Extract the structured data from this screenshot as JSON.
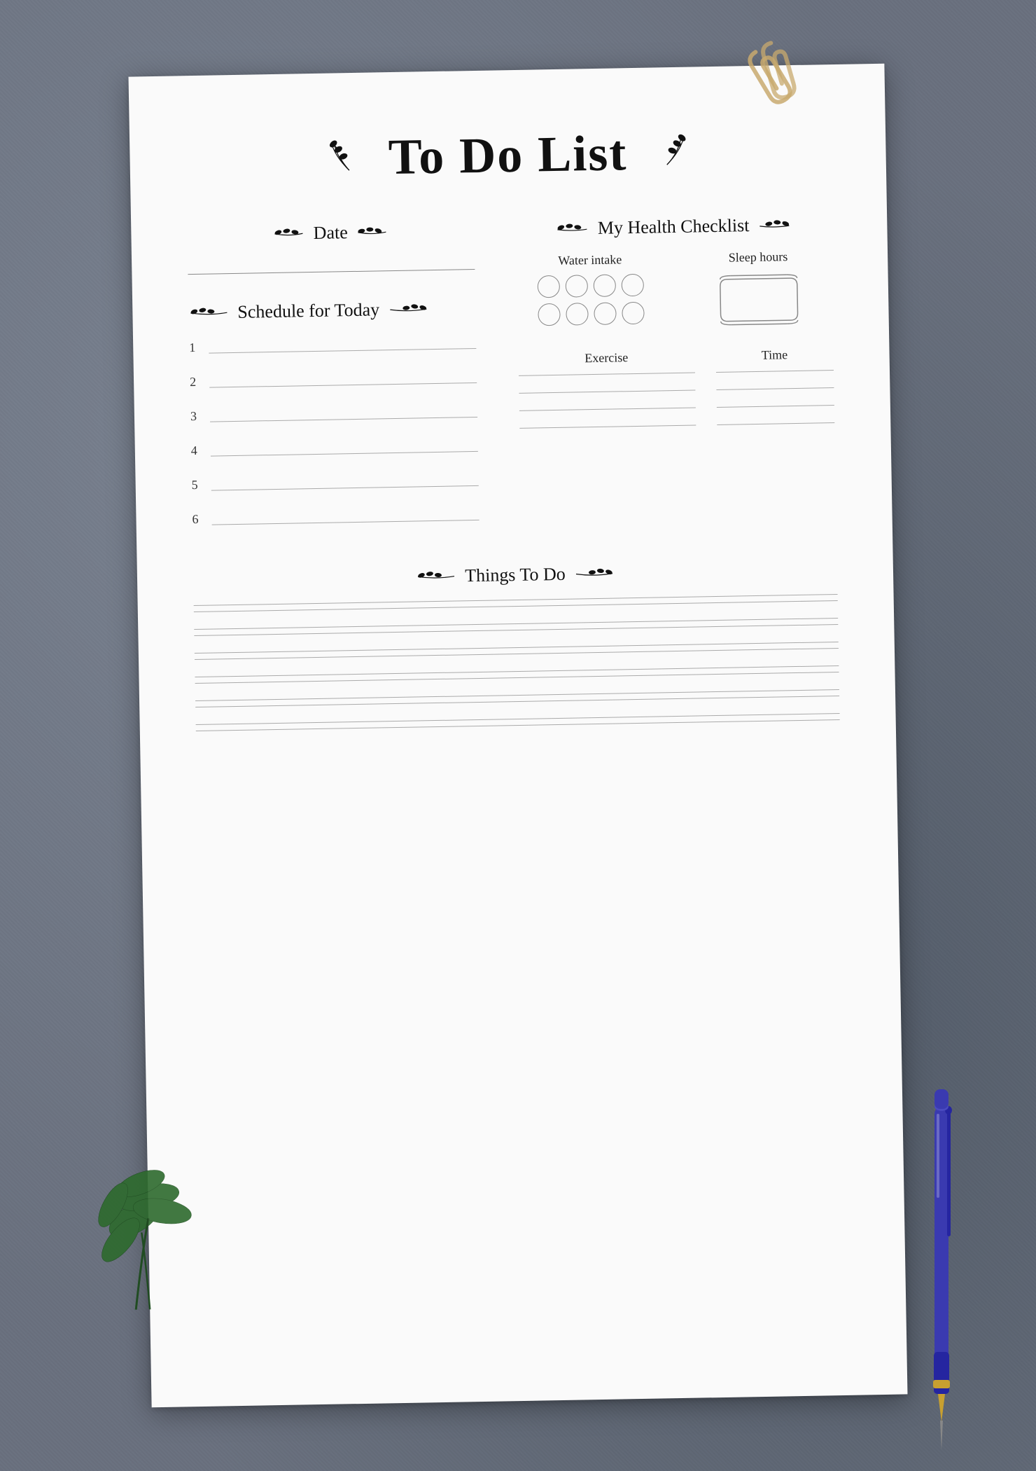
{
  "page": {
    "background": "#6b7280",
    "paper_bg": "#fafafa"
  },
  "title": "To Do List",
  "sections": {
    "date": {
      "label": "Date"
    },
    "schedule": {
      "label": "Schedule for Today",
      "items": [
        "1",
        "2",
        "3",
        "4",
        "5",
        "6"
      ]
    },
    "health": {
      "label": "My Health Checklist",
      "water": {
        "label": "Water intake",
        "circles": 8
      },
      "sleep": {
        "label": "Sleep hours"
      },
      "exercise": {
        "label": "Exercise",
        "time_label": "Time",
        "rows": 4
      }
    },
    "things": {
      "label": "Things To Do",
      "line_groups": 6
    }
  },
  "decorations": {
    "leaf_left": "❧",
    "leaf_right": "❧",
    "botanical_small": "🌿"
  }
}
